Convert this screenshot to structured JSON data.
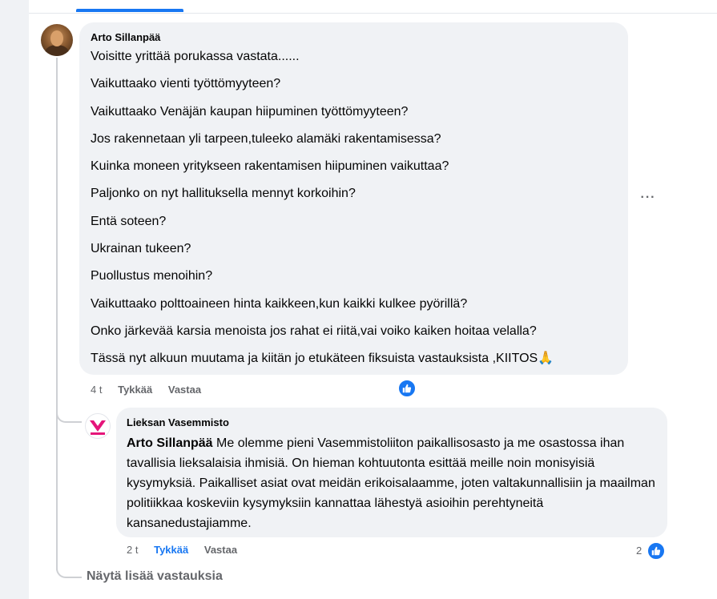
{
  "comment": {
    "author": "Arto Sillanpää",
    "lines": [
      "Voisitte yrittää porukassa vastata......",
      "Vaikuttaako vienti työttömyyteen?",
      "Vaikuttaako Venäjän kaupan hiipuminen työttömyyteen?",
      "Jos rakennetaan yli tarpeen,tuleeko alamäki rakentamisessa?",
      "Kuinka moneen yritykseen rakentamisen hiipuminen vaikuttaa?",
      "Paljonko on nyt hallituksella mennyt korkoihin?",
      "Entä soteen?",
      "Ukrainan tukeen?",
      "Puollustus menoihin?",
      "Vaikuttaako polttoaineen hinta kaikkeen,kun kaikki kulkee pyörillä?",
      "Onko järkevää karsia menoista jos rahat ei riitä,vai voiko kaiken hoitaa velalla?",
      "Tässä nyt alkuun muutama ja kiitän jo etukäteen fiksuista vastauksista ,KIITOS🙏"
    ],
    "time": "4 t",
    "like_label": "Tykkää",
    "reply_label": "Vastaa",
    "more_icon": "···"
  },
  "reply": {
    "author": "Lieksan Vasemmisto",
    "mention": "Arto Sillanpää",
    "text": "Me olemme pieni Vasemmistoliiton paikallisosasto ja me osastossa ihan tavallisia lieksalaisia ihmisiä. On hieman kohtuutonta esittää meille noin monisyisiä kysymyksiä. Paikalliset asiat ovat meidän erikoisalaamme, joten valtakunnallisiin ja maailman politiikkaa koskeviin kysymyksiin kannattaa lähestyä asioihin perehtyneitä kansanedustajiamme.",
    "time": "2 t",
    "like_label": "Tykkää",
    "reply_label": "Vastaa",
    "like_count": "2"
  },
  "more_replies": "Näytä lisää vastauksia",
  "colors": {
    "accent": "#1877f2",
    "bubble": "#f0f2f5",
    "muted": "#65676b",
    "logo": "#e5157a"
  }
}
